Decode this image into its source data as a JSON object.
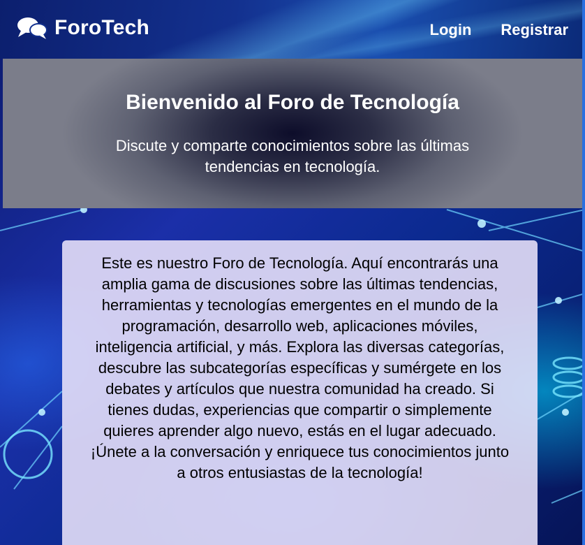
{
  "navbar": {
    "brand_name": "ForoTech",
    "brand_icon": "chat-bubbles-icon",
    "links": [
      {
        "label": "Login"
      },
      {
        "label": "Registrar"
      }
    ]
  },
  "hero": {
    "title": "Bienvenido al Foro de Tecnología",
    "subtitle": "Discute y comparte conocimientos sobre las últimas tendencias en tecnología."
  },
  "content": {
    "paragraph": "Este es nuestro Foro de Tecnología. Aquí encontrarás una amplia gama de discusiones sobre las últimas tendencias, herramientas y tecnologías emergentes en el mundo de la programación, desarrollo web, aplicaciones móviles, inteligencia artificial, y más. Explora las diversas categorías, descubre las subcategorías específicas y sumérgete en los debates y artículos que nuestra comunidad ha creado. Si tienes dudas, experiencias que compartir o simplemente quieres aprender algo nuevo, estás en el lugar adecuado. ¡Únete a la conversación y enriquece tus conocimientos junto a otros entusiastas de la tecnología!"
  },
  "colors": {
    "nav_background": "#13318f",
    "text_light": "#ffffff",
    "card_background": "#ebe4fa"
  }
}
